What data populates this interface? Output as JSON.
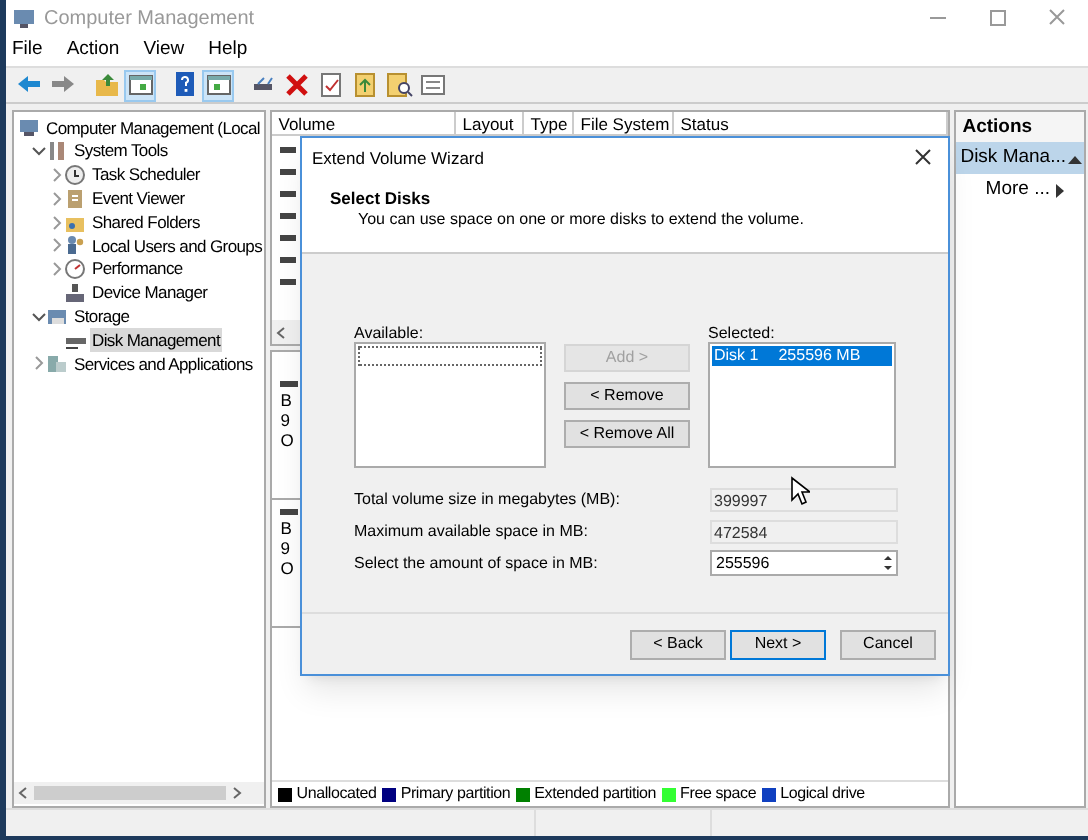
{
  "window": {
    "title": "Computer Management"
  },
  "menu": [
    "File",
    "Action",
    "View",
    "Help"
  ],
  "toolbar": [
    {
      "pressed": false
    },
    {
      "pressed": false
    },
    {
      "pressed": false
    },
    {
      "pressed": true
    },
    {
      "pressed": false
    },
    {
      "pressed": true
    },
    {
      "pressed": false
    },
    {
      "pressed": false
    },
    {
      "pressed": false
    },
    {
      "pressed": false
    },
    {
      "pressed": false
    },
    {
      "pressed": false
    }
  ],
  "tree": [
    {
      "label": "Computer Management (Local",
      "selected": false,
      "children": [
        {
          "label": "System Tools",
          "expanded": true,
          "selected": false,
          "children": [
            {
              "label": "Task Scheduler",
              "expanded": false,
              "selected": false
            },
            {
              "label": "Event Viewer",
              "expanded": false,
              "selected": false
            },
            {
              "label": "Shared Folders",
              "expanded": false,
              "selected": false
            },
            {
              "label": "Local Users and Groups",
              "expanded": false,
              "selected": false
            },
            {
              "label": "Performance",
              "expanded": false,
              "selected": false
            },
            {
              "label": "Device Manager",
              "selected": false
            }
          ]
        },
        {
          "label": "Storage",
          "expanded": true,
          "selected": false,
          "children": [
            {
              "label": "Disk Management",
              "selected": true
            }
          ]
        },
        {
          "label": "Services and Applications",
          "expanded": false,
          "selected": false
        }
      ]
    }
  ],
  "volume_list": {
    "columns": [
      "Volume",
      "Layout",
      "Type",
      "File System",
      "Status"
    ],
    "rows": [
      {
        "kind": "volume"
      },
      {
        "kind": "volume"
      },
      {
        "kind": "volume"
      },
      {
        "kind": "volume"
      },
      {
        "kind": "volume"
      },
      {
        "kind": "volume"
      },
      {
        "kind": "volume"
      }
    ]
  },
  "disks": [
    {
      "lines": [
        "B",
        "9",
        "O"
      ]
    },
    {
      "lines": [
        "B",
        "9",
        "O"
      ]
    }
  ],
  "legend": [
    {
      "label": "Unallocated",
      "color": "#000000"
    },
    {
      "label": "Primary partition",
      "color": "#000080"
    },
    {
      "label": "Extended partition",
      "color": "#008000"
    },
    {
      "label": "Free space",
      "color": "#33ff33"
    },
    {
      "label": "Logical drive",
      "color": "#1040c0"
    }
  ],
  "actions": {
    "title": "Actions",
    "items": [
      {
        "label": "Disk Mana...",
        "kind": "section",
        "selected": true
      },
      {
        "label": "More ...",
        "kind": "submenu",
        "selected": false
      }
    ]
  },
  "dialog": {
    "title": "Extend Volume Wizard",
    "heading": "Select Disks",
    "subtitle": "You can use space on one or more disks to extend the volume.",
    "available": {
      "label": "Available:"
    },
    "buttons": [
      {
        "label": "Add >",
        "disabled": true
      },
      {
        "label": "< Remove",
        "disabled": false
      },
      {
        "label": "< Remove All",
        "disabled": false
      }
    ],
    "selected": {
      "label": "Selected:",
      "items": [
        {
          "disk": "Disk 1",
          "size": "255596 MB",
          "selected": true
        }
      ]
    },
    "fields": [
      {
        "label": "Total volume size in megabytes (MB):",
        "value": "399997",
        "kind": "readonly"
      },
      {
        "label": "Maximum available space in MB:",
        "value": "472584",
        "kind": "readonly"
      },
      {
        "label": "Select the amount of space in MB:",
        "value": "255596",
        "kind": "spinner"
      }
    ],
    "footer": [
      {
        "label": "< Back",
        "default": false
      },
      {
        "label": "Next >",
        "default": true
      },
      {
        "label": "Cancel",
        "default": false
      }
    ]
  }
}
